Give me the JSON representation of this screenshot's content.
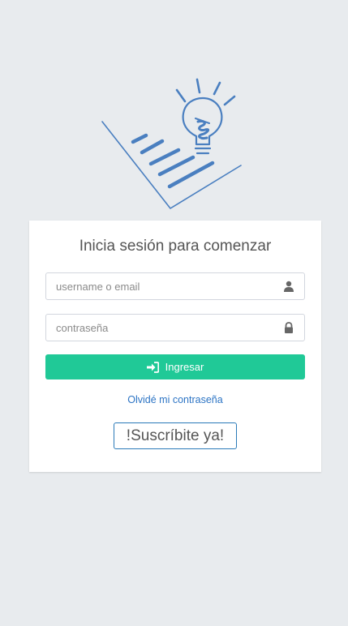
{
  "logo": {
    "icon": "lightbulb-document-icon",
    "color": "#4a7fc0"
  },
  "login": {
    "title": "Inicia sesión para comenzar",
    "username_placeholder": "username o email",
    "username_icon": "user-icon",
    "password_placeholder": "contraseña",
    "password_icon": "lock-icon",
    "submit_label": "Ingresar",
    "submit_icon": "sign-in-icon",
    "submit_color": "#20c997",
    "forgot_label": "Olvidé mi contraseña",
    "subscribe_label": "!Suscríbite ya!"
  }
}
